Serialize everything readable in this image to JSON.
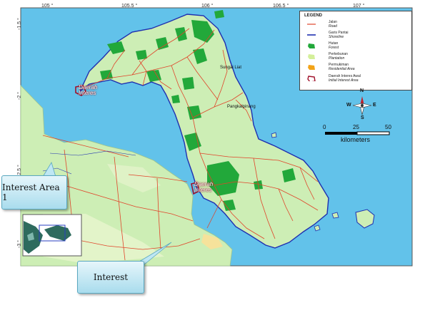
{
  "map": {
    "top_ticks": [
      "105 °",
      "105.5 °",
      "106 °",
      "106.5 °",
      "107 °"
    ],
    "left_ticks": [
      "-1.5 °",
      "-2 °",
      "-2.5 °",
      "-3 °"
    ]
  },
  "legend": {
    "title": "LEGEND",
    "items": [
      {
        "id": "jalan",
        "label": "Jalan",
        "label_en": "Road",
        "color": "#e0442a",
        "shape": "line"
      },
      {
        "id": "garis",
        "label": "Garis Pantai",
        "label_en": "Shoreline",
        "color": "#1f2fb0",
        "shape": "line"
      },
      {
        "id": "hutan",
        "label": "Hutan",
        "label_en": "Forest",
        "color": "#22a83a",
        "shape": "blob"
      },
      {
        "id": "perkebunan",
        "label": "Perkebunan",
        "label_en": "Plantation",
        "color": "#d4ef9a",
        "shape": "blob"
      },
      {
        "id": "permukiman",
        "label": "Permukiman",
        "label_en": "Residential Area",
        "color": "#f2a318",
        "shape": "blob"
      },
      {
        "id": "daerah",
        "label": "Daerah Interes Awal",
        "label_en": "Initial Interest Area",
        "color": "#a0102a",
        "shape": "outline"
      }
    ]
  },
  "scale": {
    "labels": [
      "0",
      "25",
      "50"
    ],
    "unit": "kilometers"
  },
  "compass": {
    "n": "N",
    "s": "S",
    "e": "E",
    "w": "W"
  },
  "places": {
    "sungailiat": "Sungai Liat",
    "pangkalpinang": "Pangkalpinang"
  },
  "interest_labels": [
    {
      "line1": "Daerah",
      "line2": "Interes"
    },
    {
      "line1": "Daerah",
      "line2": "Interes"
    }
  ],
  "callouts": {
    "area1": "Interest Area 1",
    "interest": "Interest"
  },
  "colors": {
    "sea": "#62c2ea",
    "land": "#cdeeb5",
    "forest": "#22a83a",
    "road": "#e0442a",
    "shoreline": "#1f2fb0"
  }
}
